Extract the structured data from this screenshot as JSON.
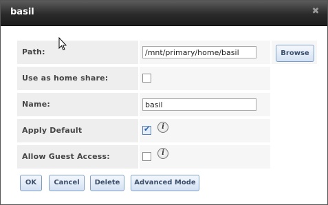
{
  "dialog": {
    "title": "basil",
    "close_icon": "close-icon"
  },
  "form": {
    "path": {
      "label": "Path:",
      "value": "/mnt/primary/home/basil",
      "browse_label": "Browse"
    },
    "home_share": {
      "label": "Use as home share:",
      "checked": false
    },
    "name": {
      "label": "Name:",
      "value": "basil"
    },
    "default_perms": {
      "label": "Apply Default Permissions:",
      "checked": true,
      "info_icon": "info-icon"
    },
    "guest_access": {
      "label": "Allow Guest Access:",
      "checked": false,
      "info_icon": "info-icon"
    }
  },
  "buttons": {
    "ok": "OK",
    "cancel": "Cancel",
    "delete": "Delete",
    "advanced": "Advanced Mode"
  },
  "colors": {
    "titlebar": "#2a2a2a",
    "button_border": "#7d9cc4",
    "label_bg": "#eeeeee"
  }
}
